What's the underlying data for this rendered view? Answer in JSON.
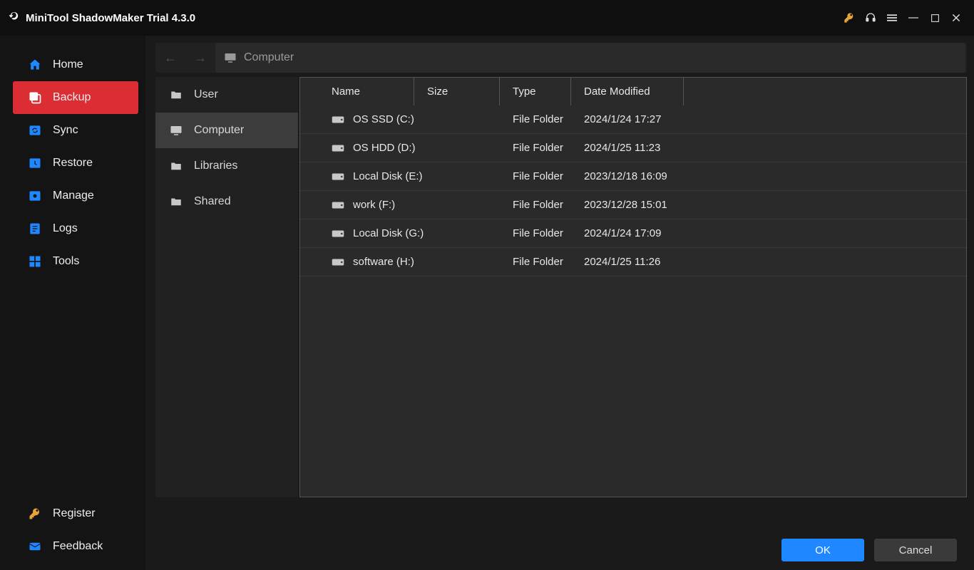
{
  "title": "MiniTool ShadowMaker Trial 4.3.0",
  "sidebar": {
    "items": [
      {
        "label": "Home"
      },
      {
        "label": "Backup"
      },
      {
        "label": "Sync"
      },
      {
        "label": "Restore"
      },
      {
        "label": "Manage"
      },
      {
        "label": "Logs"
      },
      {
        "label": "Tools"
      }
    ],
    "footer": [
      {
        "label": "Register"
      },
      {
        "label": "Feedback"
      }
    ]
  },
  "path": {
    "location": "Computer"
  },
  "tree": [
    {
      "label": "User"
    },
    {
      "label": "Computer"
    },
    {
      "label": "Libraries"
    },
    {
      "label": "Shared"
    }
  ],
  "columns": {
    "name": "Name",
    "size": "Size",
    "type": "Type",
    "date": "Date Modified"
  },
  "rows": [
    {
      "name": "OS SSD (C:)",
      "type": "File Folder",
      "date": "2024/1/24 17:27"
    },
    {
      "name": "OS HDD (D:)",
      "type": "File Folder",
      "date": "2024/1/25 11:23"
    },
    {
      "name": "Local Disk (E:)",
      "type": "File Folder",
      "date": "2023/12/18 16:09"
    },
    {
      "name": "work (F:)",
      "type": "File Folder",
      "date": "2023/12/28 15:01"
    },
    {
      "name": "Local Disk (G:)",
      "type": "File Folder",
      "date": "2024/1/24 17:09"
    },
    {
      "name": "software (H:)",
      "type": "File Folder",
      "date": "2024/1/25 11:26"
    }
  ],
  "buttons": {
    "ok": "OK",
    "cancel": "Cancel"
  }
}
